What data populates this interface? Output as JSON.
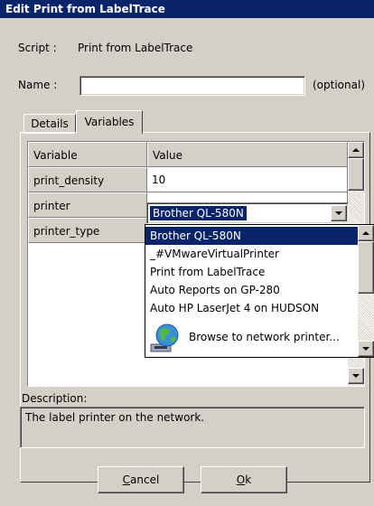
{
  "window": {
    "title": "Edit Print from LabelTrace"
  },
  "script": {
    "label": "Script :",
    "value": "Print from LabelTrace"
  },
  "name": {
    "label": "Name :",
    "value": "",
    "hint": "(optional)"
  },
  "tabs": [
    {
      "label": "Details",
      "active": false
    },
    {
      "label": "Variables",
      "active": true
    }
  ],
  "grid": {
    "headers": [
      "Variable",
      "Value"
    ],
    "rows": [
      {
        "variable": "print_density",
        "value": "10"
      },
      {
        "variable": "printer",
        "value": "Brother QL-580N"
      },
      {
        "variable": "printer_type",
        "value": ""
      }
    ]
  },
  "printer_dropdown": {
    "selected": "Brother QL-580N",
    "options": [
      "Brother QL-580N",
      "_#VMwareVirtualPrinter",
      "Print from LabelTrace",
      "Auto Reports on GP-280",
      "Auto HP LaserJet 4 on HUDSON",
      "Browse to network printer..."
    ]
  },
  "description": {
    "label": "Description:",
    "text": "The label printer on the network."
  },
  "buttons": {
    "cancel": "Cancel",
    "ok": "Ok"
  },
  "colors": {
    "titlebar": "#0a246a",
    "selection": "#0a246a",
    "face": "#d4d0c8"
  },
  "icons": [
    "network-globe-icon",
    "scroll-up-icon",
    "scroll-down-icon",
    "dropdown-arrow-icon"
  ]
}
